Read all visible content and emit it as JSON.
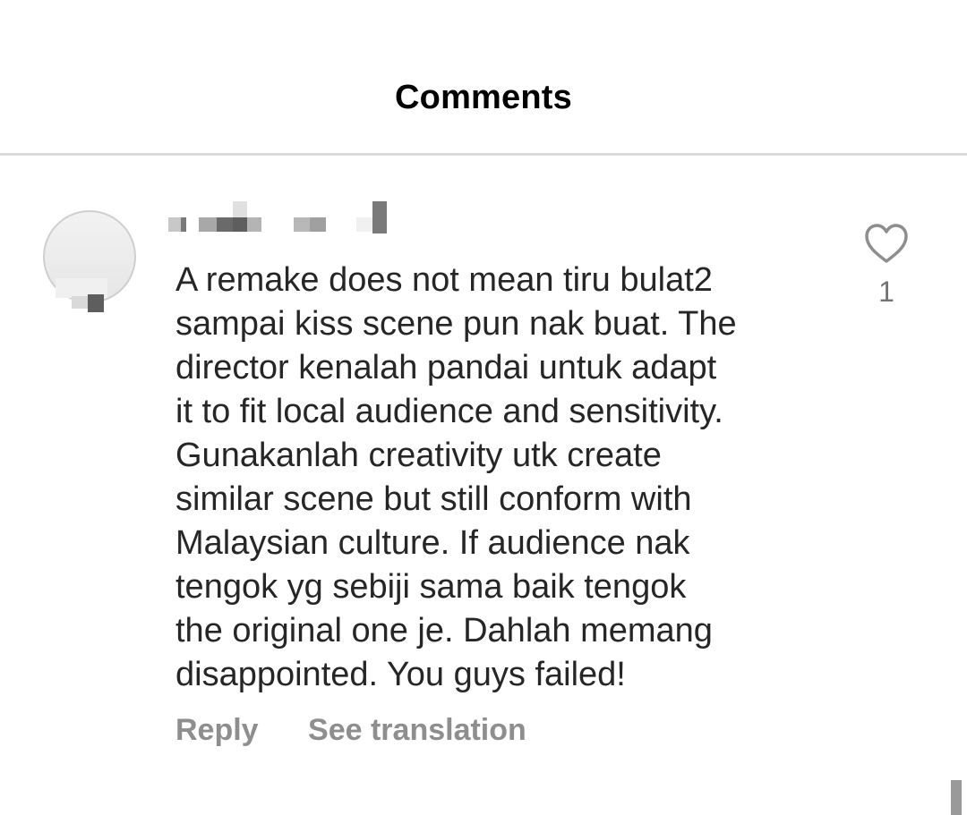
{
  "header": {
    "title": "Comments"
  },
  "comment": {
    "username": "",
    "text": "A remake does not mean tiru bulat2\nsampai kiss scene pun nak buat. The\ndirector kenalah pandai untuk adapt\nit to fit local audience and sensitivity.\nGunakanlah creativity utk create\nsimilar scene but still conform with\nMalaysian culture. If audience nak\ntengok yg sebiji sama baik tengok\nthe original one je. Dahlah memang\ndisappointed. You guys failed!",
    "reply_label": "Reply",
    "translate_label": "See translation",
    "like_count": "1",
    "like_icon": "heart-outline-icon"
  },
  "colors": {
    "text": "#262626",
    "muted": "#8e8e8e",
    "divider": "#dbdbdb"
  }
}
